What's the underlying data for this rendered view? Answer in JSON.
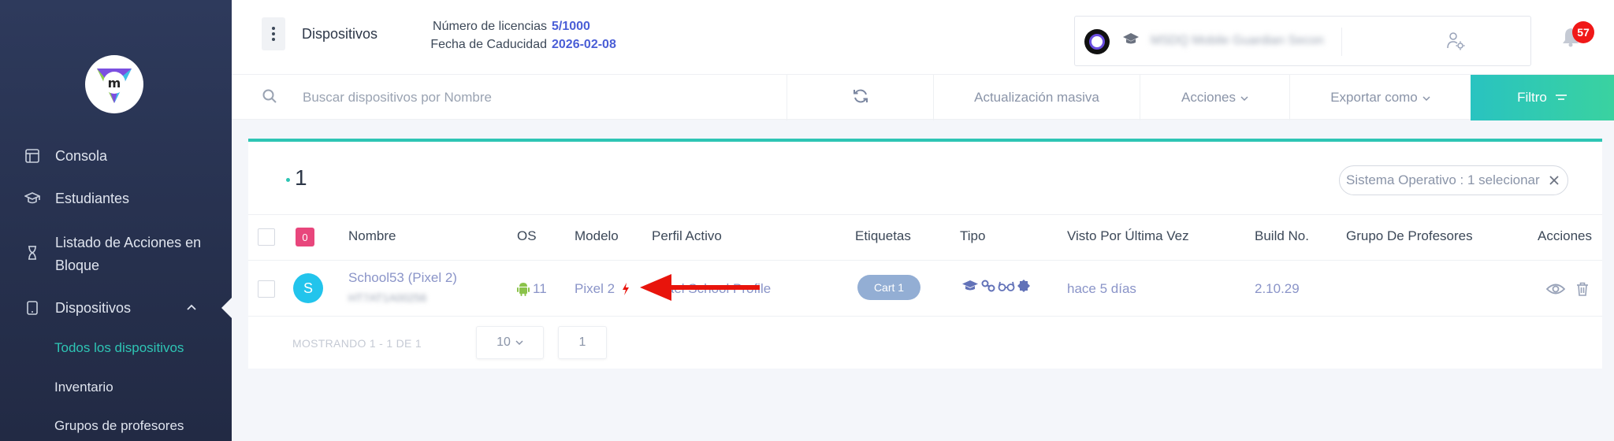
{
  "sidebar": {
    "items": [
      {
        "label": "Consola",
        "icon": "layout-icon"
      },
      {
        "label": "Estudiantes",
        "icon": "graduation-cap-icon"
      },
      {
        "label": "Listado de Acciones en",
        "label2": "Bloque",
        "icon": "hourglass-icon"
      },
      {
        "label": "Dispositivos",
        "icon": "tablet-icon"
      }
    ],
    "subitems": [
      "Todos los dispositivos",
      "Inventario",
      "Grupos de profesores"
    ]
  },
  "header": {
    "title": "Dispositivos",
    "license_label": "Número de licencias",
    "license_value": "5/1000",
    "expiry_label": "Fecha de Caducidad",
    "expiry_value": "2026-02-08",
    "user_name": "MSDQ Mobile Guardian Secondary",
    "notification_count": "57"
  },
  "toolbar": {
    "search_placeholder": "Buscar dispositivos por Nombre",
    "bulk_update": "Actualización masiva",
    "actions": "Acciones",
    "export": "Exportar como",
    "filter": "Filtro"
  },
  "card": {
    "count": "1",
    "filter_chip": "Sistema Operativo : 1 selecionar",
    "selected_count": "0",
    "columns": [
      "Nombre",
      "OS",
      "Modelo",
      "Perfil Activo",
      "Etiquetas",
      "Tipo",
      "Visto Por Última Vez",
      "Build No.",
      "Grupo De Profesores",
      "Acciones"
    ],
    "rows": [
      {
        "avatar": "S",
        "name": "School53 (Pixel 2)",
        "serial": "HT7AT1A00256",
        "os_version": "11",
        "model": "Pixel 2",
        "profile": "Israel School Profile",
        "tag": "Cart 1",
        "last_seen": "hace 5 días",
        "build": "2.10.29"
      }
    ],
    "footer_text": "MOSTRANDO 1 - 1 DE 1",
    "page_size": "10",
    "page": "1"
  },
  "colors": {
    "sidebar_bg": "#2e3a5c",
    "accent_teal": "#2ec5b4",
    "link_blue": "#4a5ed6",
    "badge_pink": "#e8467c",
    "arrow_red": "#e8140c"
  }
}
